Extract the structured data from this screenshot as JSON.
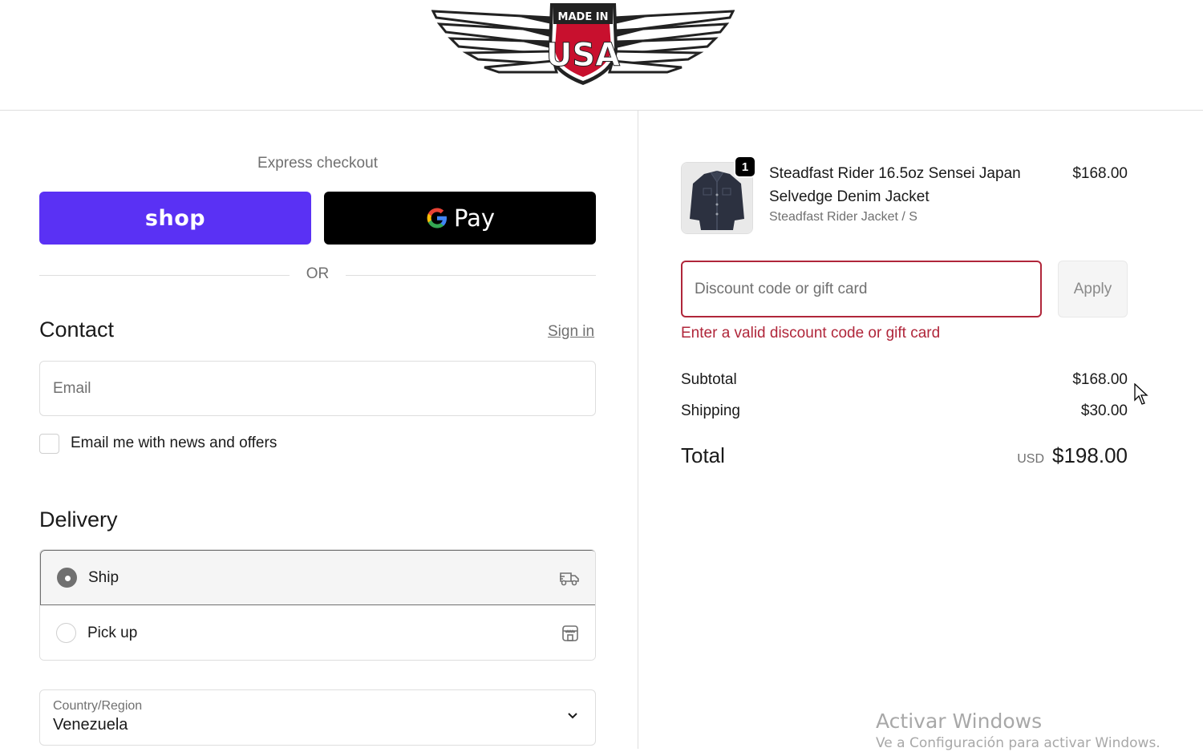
{
  "header": {
    "logo_text_top": "MADE IN",
    "logo_text_main": "USA"
  },
  "express": {
    "label": "Express checkout",
    "shop_label": "shop",
    "gpay_label": "Pay",
    "or_label": "OR"
  },
  "contact": {
    "title": "Contact",
    "sign_in": "Sign in",
    "email_placeholder": "Email",
    "email_value": "",
    "newsletter_label": "Email me with news and offers",
    "newsletter_checked": false
  },
  "delivery": {
    "title": "Delivery",
    "options": [
      {
        "label": "Ship",
        "selected": true,
        "icon": "truck-icon"
      },
      {
        "label": "Pick up",
        "selected": false,
        "icon": "store-icon"
      }
    ],
    "country_label": "Country/Region",
    "country_value": "Venezuela"
  },
  "order": {
    "quantity": "1",
    "product_name": "Steadfast Rider 16.5oz Sensei Japan Selvedge Denim Jacket",
    "variant": "Steadfast Rider Jacket / S",
    "price": "$168.00"
  },
  "discount": {
    "placeholder": "Discount code or gift card",
    "value": "",
    "apply_label": "Apply",
    "error": "Enter a valid discount code or gift card"
  },
  "summary": {
    "subtotal_label": "Subtotal",
    "subtotal_value": "$168.00",
    "shipping_label": "Shipping",
    "shipping_value": "$30.00",
    "total_label": "Total",
    "currency": "USD",
    "total_value": "$198.00"
  },
  "watermark": {
    "title": "Activar Windows",
    "subtitle": "Ve a Configuración para activar Windows."
  },
  "colors": {
    "shop_purple": "#5a31f4",
    "error_red": "#b0263a",
    "muted_text": "#707070",
    "border": "#dedede"
  }
}
